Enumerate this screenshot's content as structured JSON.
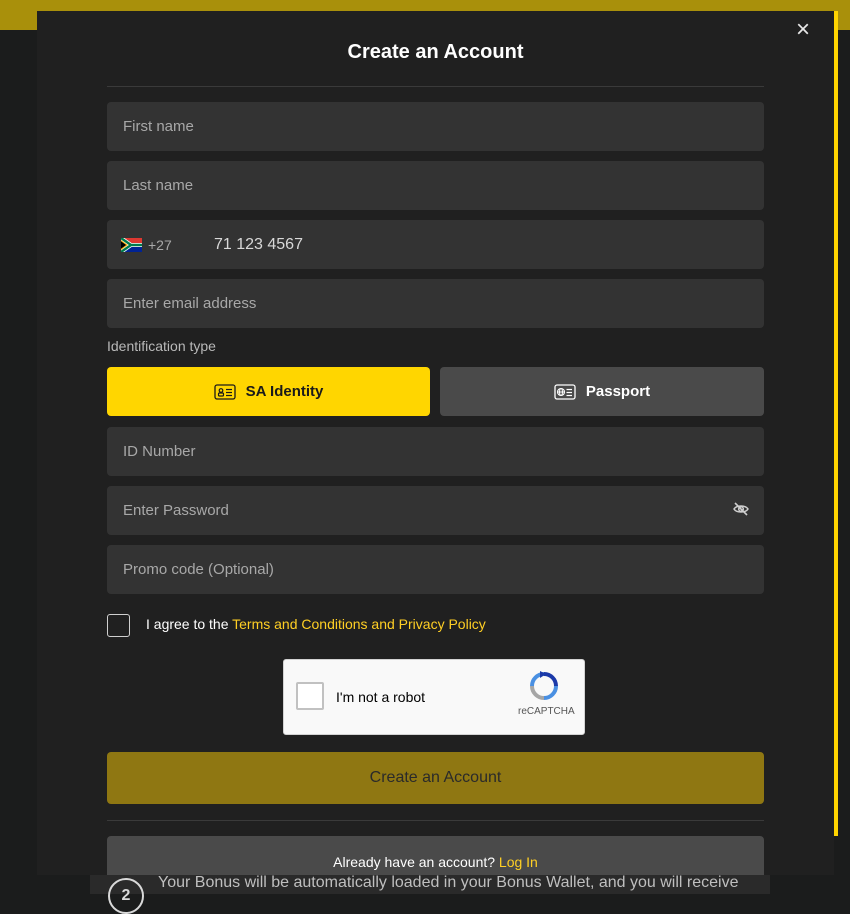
{
  "background": {
    "bonus_step": "2",
    "bonus_text": "Your Bonus will be automatically loaded in your Bonus Wallet, and you will receive"
  },
  "modal": {
    "title": "Create an Account",
    "close_symbol": "×"
  },
  "form": {
    "first_name_placeholder": "First name",
    "last_name_placeholder": "Last name",
    "phone": {
      "country_flag": "south-africa-flag-icon",
      "dial_code": "+27",
      "placeholder_value": "71 123 4567"
    },
    "email_placeholder": "Enter email address",
    "id_type_label": "Identification type",
    "id_types": [
      {
        "label": "SA Identity",
        "icon": "id-card-icon",
        "selected": true
      },
      {
        "label": "Passport",
        "icon": "passport-icon",
        "selected": false
      }
    ],
    "id_number_placeholder": "ID Number",
    "password_placeholder": "Enter Password",
    "promo_placeholder": "Promo code (Optional)",
    "agree_prefix": "I agree to the ",
    "agree_link": "Terms and Conditions and Privacy Policy",
    "recaptcha": {
      "label": "I'm not a robot",
      "brand": "reCAPTCHA"
    },
    "submit_label": "Create an Account",
    "login_prompt": "Already have an account?",
    "login_link": "Log In"
  },
  "colors": {
    "accent": "#ffd600",
    "link": "#ffcf24",
    "submit_disabled": "#8f7712"
  }
}
